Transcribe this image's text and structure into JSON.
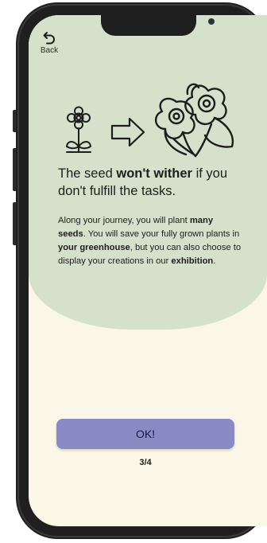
{
  "header": {
    "back_label": "Back",
    "back_icon": "undo-arrow-icon"
  },
  "illustration": {
    "small_icon": "flower-icon",
    "arrow_icon": "right-arrow-icon",
    "large_icon": "bouquet-icon"
  },
  "headline": {
    "part1": "The seed ",
    "bold1": "won't wither",
    "part2": " if you don't fulfill the tasks."
  },
  "body": {
    "t1": "Along your journey, you will plant ",
    "b1": "many seeds",
    "t2": ". You will save your fully grown plants in ",
    "b2": "your greenhouse",
    "t3": ", but you can also choose to display your creations in our ",
    "b3": "exhibition",
    "t4": "."
  },
  "actions": {
    "ok_label": "OK!"
  },
  "pager": {
    "text": "3/4"
  },
  "colors": {
    "screen_bg": "#fbf7e8",
    "panel_bg": "#d5e1cb",
    "button_bg": "#8a8ac4",
    "frame": "#1f1f1f"
  }
}
